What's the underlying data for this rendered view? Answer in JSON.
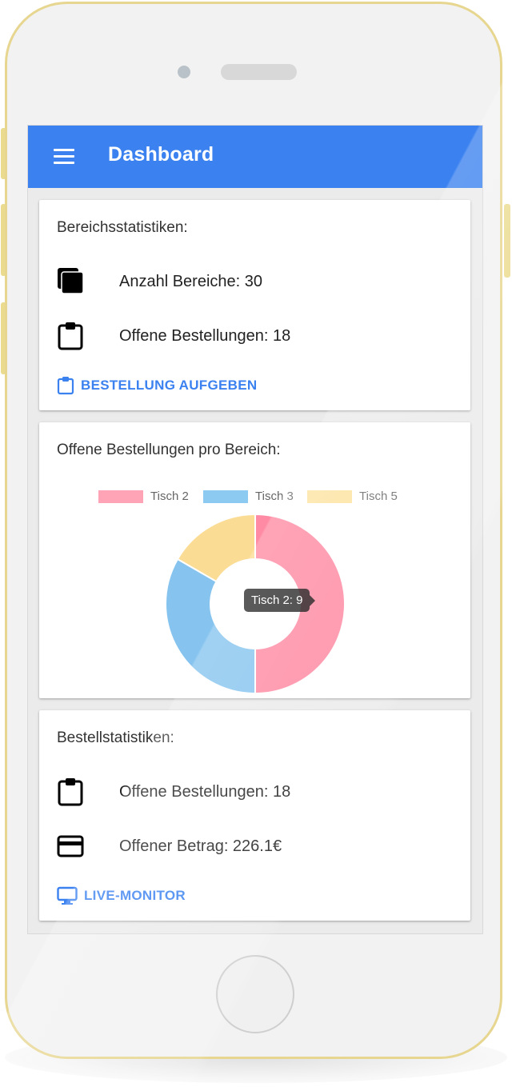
{
  "appbar": {
    "title": "Dashboard",
    "menu_icon": "menu-icon",
    "color": "#3b82f0"
  },
  "area_stats": {
    "title": "Bereichsstatistiken:",
    "rows": [
      {
        "icon": "library-icon",
        "label": "Anzahl Bereiche: 30"
      },
      {
        "icon": "clipboard-icon",
        "label": "Offene Bestellungen: 18"
      }
    ],
    "action": {
      "icon": "clipboard-icon",
      "label": "BESTELLUNG AUFGEBEN"
    }
  },
  "orders_chart": {
    "title": "Offene Bestellungen pro Bereich:",
    "tooltip": "Tisch 2: 9"
  },
  "chart_data": {
    "type": "pie",
    "variant": "doughnut",
    "categories": [
      "Tisch 2",
      "Tisch 3",
      "Tisch 5"
    ],
    "values": [
      9,
      6,
      3
    ],
    "colors": [
      "#ff8aa3",
      "#86c4ef",
      "#fbdc94"
    ],
    "legend_position": "top"
  },
  "order_stats": {
    "title": "Bestellstatistiken:",
    "rows": [
      {
        "icon": "clipboard-icon",
        "label": "Offene Bestellungen: 18"
      },
      {
        "icon": "credit-card-icon",
        "label": "Offener Betrag: 226.1€"
      }
    ],
    "action": {
      "icon": "monitor-icon",
      "label": "LIVE-MONITOR"
    }
  }
}
